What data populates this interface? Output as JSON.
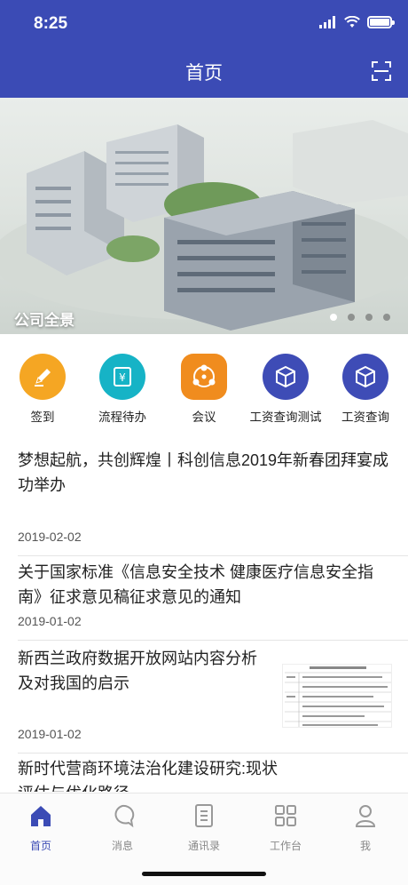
{
  "status_bar": {
    "time": "8:25"
  },
  "nav": {
    "title": "首页"
  },
  "banner": {
    "caption": "公司全景",
    "page_count": 4,
    "active_page": 1
  },
  "quick_actions": [
    {
      "label": "签到",
      "icon": "pen-icon",
      "color": "#f5a623"
    },
    {
      "label": "流程待办",
      "icon": "ticket-icon",
      "color": "#16b3c6"
    },
    {
      "label": "会议",
      "icon": "meeting-icon",
      "color": "#f08c1e"
    },
    {
      "label": "工资查询测试",
      "icon": "cube-icon",
      "color": "#3e4cb6"
    },
    {
      "label": "工资查询",
      "icon": "cube-icon",
      "color": "#3e4cb6"
    }
  ],
  "news": [
    {
      "title": "梦想起航，共创辉煌丨科创信息2019年新春团拜宴成功举办",
      "date": "2019-02-02"
    },
    {
      "title": "关于国家标准《信息安全技术 健康医疗信息安全指南》征求意见稿征求意见的通知",
      "date": "2019-01-02"
    },
    {
      "title": "新西兰政府数据开放网站内容分析及对我国的启示",
      "date": "2019-01-02"
    },
    {
      "title": "新时代营商环境法治化建设研究:现状评估与优化路径",
      "date": ""
    }
  ],
  "tabs": [
    {
      "label": "首页",
      "icon": "home-icon",
      "active": true
    },
    {
      "label": "消息",
      "icon": "message-icon",
      "active": false
    },
    {
      "label": "通讯录",
      "icon": "contacts-icon",
      "active": false
    },
    {
      "label": "工作台",
      "icon": "grid-icon",
      "active": false
    },
    {
      "label": "我",
      "icon": "user-icon",
      "active": false
    }
  ],
  "colors": {
    "primary": "#3b4bb5",
    "tab_inactive": "#888888"
  }
}
